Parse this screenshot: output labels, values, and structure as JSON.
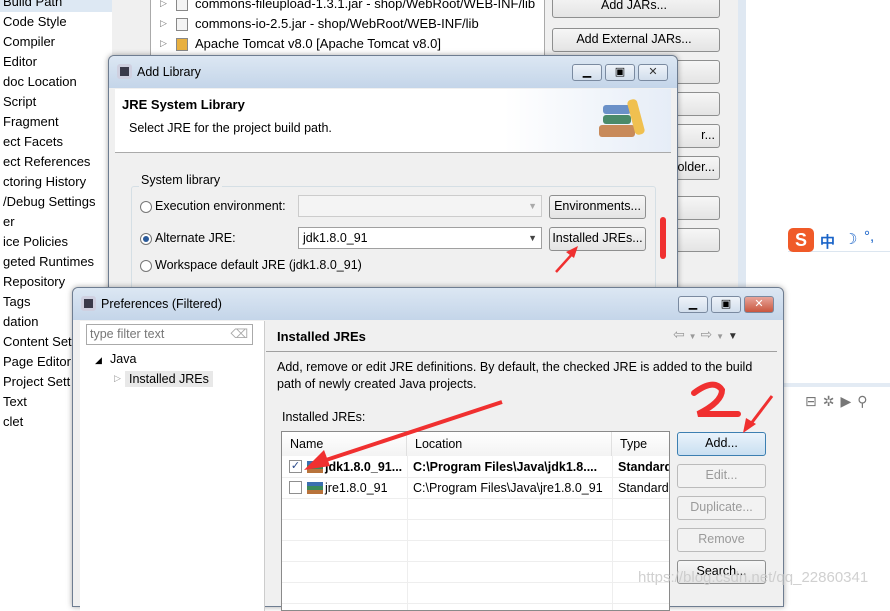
{
  "left_list": [
    "Build Path",
    "Code Style",
    "Compiler",
    "Editor",
    "doc Location",
    "Script",
    "Fragment",
    "ect Facets",
    "ect References",
    "ctoring History",
    "/Debug Settings",
    "er",
    "ice Policies",
    "geted Runtimes",
    "Repository",
    "Tags",
    "dation",
    "Content Set",
    "Page Editor",
    "Project Sett",
    "Text",
    "clet"
  ],
  "build_path": {
    "tree": [
      "commons-fileupload-1.3.1.jar - shop/WebRoot/WEB-INF/lib",
      "commons-io-2.5.jar - shop/WebRoot/WEB-INF/lib",
      "Apache Tomcat v8.0 [Apache Tomcat v8.0]"
    ],
    "buttons": [
      "Add JARs...",
      "Add External JARs...",
      "",
      "",
      "r...",
      "older...",
      "",
      ""
    ]
  },
  "add_library": {
    "title": "Add Library",
    "header_title": "JRE System Library",
    "header_desc": "Select JRE for the project build path.",
    "group_label": "System library",
    "options": [
      {
        "label": "Execution environment:",
        "value": "",
        "selected": false,
        "button": "Environments..."
      },
      {
        "label": "Alternate JRE:",
        "value": "jdk1.8.0_91",
        "selected": true,
        "button": "Installed JREs..."
      },
      {
        "label": "Workspace default JRE (jdk1.8.0_91)",
        "selected": false
      }
    ]
  },
  "preferences": {
    "title": "Preferences (Filtered)",
    "filter_placeholder": "type filter text",
    "tree": {
      "root": "Java",
      "child": "Installed JREs"
    },
    "page_title": "Installed JREs",
    "description": "Add, remove or edit JRE definitions. By default, the checked JRE is added to the build path of newly created Java projects.",
    "table_label": "Installed JREs:",
    "columns": [
      "Name",
      "Location",
      "Type"
    ],
    "rows": [
      {
        "checked": true,
        "name": "jdk1.8.0_91...",
        "location": "C:\\Program Files\\Java\\jdk1.8....",
        "type": "Standard"
      },
      {
        "checked": false,
        "name": "jre1.8.0_91",
        "location": "C:\\Program Files\\Java\\jre1.8.0_91",
        "type": "Standard"
      }
    ],
    "buttons": {
      "add": "Add...",
      "edit": "Edit...",
      "duplicate": "Duplicate...",
      "remove": "Remove",
      "search": "Search..."
    }
  },
  "annotations": {
    "one": "1",
    "two": "2",
    "color": "#f03030"
  },
  "ime": {
    "lang": "中"
  },
  "watermark": "https://blog.csdn.net/qq_22860341"
}
